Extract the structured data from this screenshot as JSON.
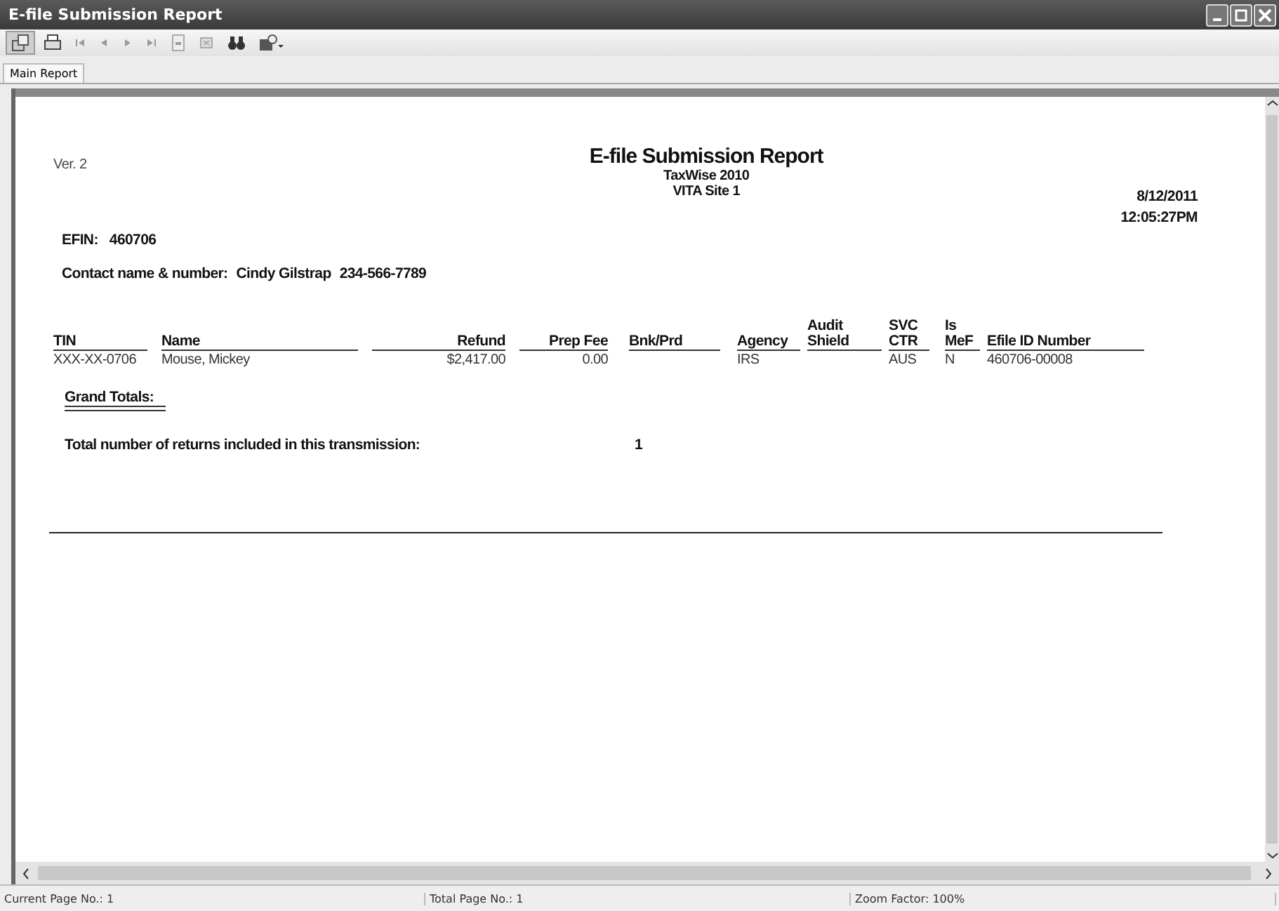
{
  "window": {
    "title": "E-file Submission Report"
  },
  "tabs": [
    {
      "label": "Main Report",
      "selected": true
    }
  ],
  "report": {
    "version": "Ver. 2",
    "title": "E-file Submission Report",
    "subtitle_lines": [
      "TaxWise 2010",
      "VITA Site 1"
    ],
    "date": "8/12/2011",
    "time": "12:05:27PM",
    "efin_label": "EFIN:",
    "efin": "460706",
    "contact_label": "Contact name & number:",
    "contact_name": "Cindy Gilstrap",
    "contact_phone": "234-566-7789",
    "columns": [
      {
        "lines": [
          "TIN"
        ]
      },
      {
        "lines": [
          "Name"
        ]
      },
      {
        "lines": [
          "Refund"
        ]
      },
      {
        "lines": [
          "Prep Fee"
        ]
      },
      {
        "lines": [
          "Bnk/Prd"
        ]
      },
      {
        "lines": [
          "Agency"
        ]
      },
      {
        "lines": [
          "Audit",
          "Shield"
        ]
      },
      {
        "lines": [
          "SVC",
          "CTR"
        ]
      },
      {
        "lines": [
          "Is",
          "MeF"
        ]
      },
      {
        "lines": [
          "Efile ID Number"
        ]
      }
    ],
    "rows": [
      [
        "XXX-XX-0706",
        "Mouse, Mickey",
        "$2,417.00",
        "0.00",
        "",
        "IRS",
        "",
        "AUS",
        "N",
        "460706-00008"
      ]
    ],
    "grand_totals_label": "Grand Totals:",
    "total_returns_label": "Total number of returns included in this transmission:",
    "total_returns_value": "1"
  },
  "status_bar": [
    "Current Page No.: 1",
    "Total Page No.: 1",
    "Zoom Factor: 100%"
  ]
}
